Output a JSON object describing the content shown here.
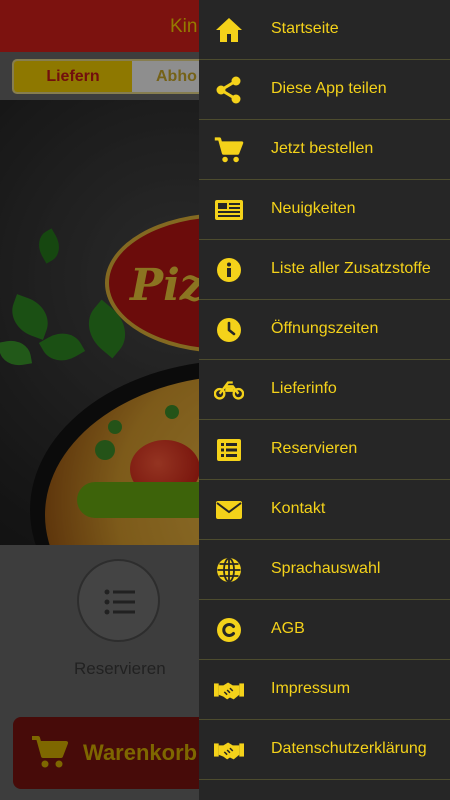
{
  "app": {
    "title": "Kin",
    "tabs": {
      "deliver": "Liefern",
      "pickup": "Abho"
    },
    "hero_logo_text": "Pizz",
    "reserve_label": "Reservieren",
    "cart_label": "Warenkorb"
  },
  "drawer": {
    "items": [
      {
        "label": "Startseite",
        "icon": "home-icon"
      },
      {
        "label": "Diese App teilen",
        "icon": "share-icon"
      },
      {
        "label": "Jetzt bestellen",
        "icon": "cart-icon"
      },
      {
        "label": "Neuigkeiten",
        "icon": "newspaper-icon"
      },
      {
        "label": "Liste aller Zusatzstoffe",
        "icon": "info-icon"
      },
      {
        "label": "Öffnungszeiten",
        "icon": "clock-icon"
      },
      {
        "label": "Lieferinfo",
        "icon": "motorcycle-icon"
      },
      {
        "label": "Reservieren",
        "icon": "list-icon"
      },
      {
        "label": "Kontakt",
        "icon": "envelope-icon"
      },
      {
        "label": "Sprachauswahl",
        "icon": "globe-icon"
      },
      {
        "label": "AGB",
        "icon": "copyright-icon"
      },
      {
        "label": "Impressum",
        "icon": "handshake-icon"
      },
      {
        "label": "Datenschutzerklärung",
        "icon": "handshake-icon"
      }
    ]
  },
  "colors": {
    "accent_yellow": "#f4d21a",
    "brand_red": "#d6201b",
    "drawer_bg": "#262626"
  }
}
